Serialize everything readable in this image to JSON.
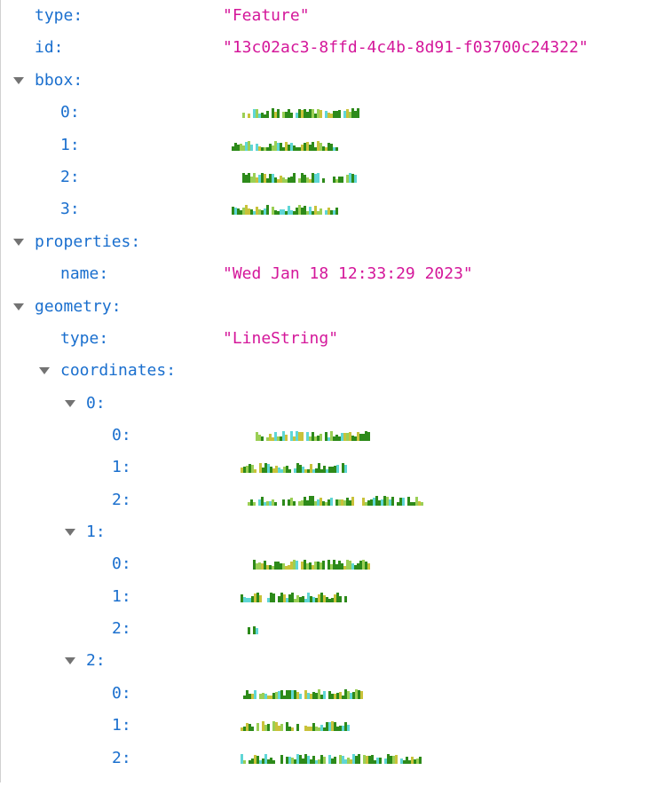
{
  "root": {
    "type_key": "type:",
    "type_value": "\"Feature\"",
    "id_key": "id:",
    "id_value": "\"13c02ac3-8ffd-4c4b-8d91-f03700c24322\"",
    "bbox": {
      "key": "bbox:",
      "items": [
        {
          "key": "0:"
        },
        {
          "key": "1:"
        },
        {
          "key": "2:"
        },
        {
          "key": "3:"
        }
      ]
    },
    "properties": {
      "key": "properties:",
      "name_key": "name:",
      "name_value": "\"Wed Jan 18 12:33:29 2023\""
    },
    "geometry": {
      "key": "geometry:",
      "type_key": "type:",
      "type_value": "\"LineString\"",
      "coordinates": {
        "key": "coordinates:",
        "points": [
          {
            "key": "0:",
            "items": [
              {
                "key": "0:"
              },
              {
                "key": "1:"
              },
              {
                "key": "2:"
              }
            ]
          },
          {
            "key": "1:",
            "items": [
              {
                "key": "0:"
              },
              {
                "key": "1:"
              },
              {
                "key": "2:"
              }
            ]
          },
          {
            "key": "2:",
            "items": [
              {
                "key": "0:"
              },
              {
                "key": "1:"
              },
              {
                "key": "2:"
              }
            ]
          }
        ]
      }
    }
  },
  "colors": {
    "key": "#1a6fce",
    "string": "#d4179a",
    "twisty": "#737373",
    "pixel_green": "#2d8a1a",
    "pixel_light": "#9bcf55",
    "pixel_cyan": "#5fd6d6",
    "pixel_yellow": "#c9c23a"
  },
  "icons": {
    "expand": "chevron-down-icon",
    "redacted": "pixelated-number"
  }
}
